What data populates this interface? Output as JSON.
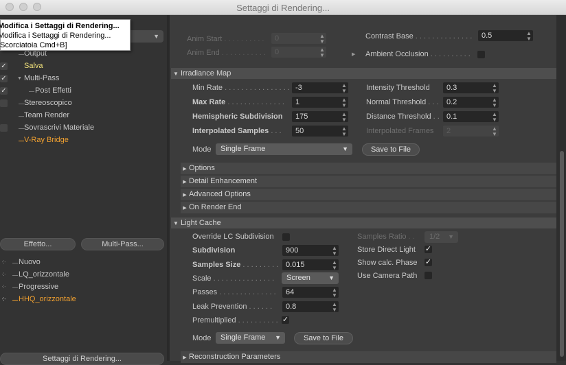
{
  "window": {
    "title": "Settaggi di Rendering..."
  },
  "tooltip": {
    "line1": "Modifica i Settaggi di Rendering...",
    "line2": "Modifica i Settaggi di Rendering...",
    "line3": "[Scorciatoia Cmd+B]"
  },
  "left": {
    "items": [
      {
        "label": "Output",
        "checked": false,
        "color": "#c8c8c8"
      },
      {
        "label": "Salva",
        "checked": true,
        "color": "#f0e07a"
      },
      {
        "label": "Multi-Pass",
        "checked": true,
        "color": "#c8c8c8"
      },
      {
        "label": "Post Effetti",
        "checked": true,
        "color": "#c8c8c8"
      },
      {
        "label": "Stereoscopico",
        "checked": false,
        "color": "#c8c8c8"
      },
      {
        "label": "Team Render",
        "checked": false,
        "color": "#c8c8c8"
      },
      {
        "label": "Sovrascrivi Materiale",
        "checked": false,
        "color": "#c8c8c8"
      },
      {
        "label": "V-Ray Bridge",
        "checked": false,
        "color": "#f0a030"
      }
    ],
    "effect_button": "Effetto...",
    "multipass_button": "Multi-Pass...",
    "presets": [
      {
        "label": "Nuovo",
        "color": "#c8c8c8"
      },
      {
        "label": "LQ_orizzontale",
        "color": "#c8c8c8"
      },
      {
        "label": "Progressive",
        "color": "#c8c8c8"
      },
      {
        "label": "HHQ_orizzontale",
        "color": "#f0a030"
      }
    ],
    "render_settings_button": "Settaggi di Rendering..."
  },
  "top": {
    "anim_start_label": "Anim Start",
    "anim_start_value": "0",
    "anim_end_label": "Anim End",
    "anim_end_value": "0",
    "contrast_base_label": "Contrast Base",
    "contrast_base_value": "0.5",
    "ambient_occlusion_label": "Ambient Occlusion"
  },
  "irradiance": {
    "title": "Irradiance Map",
    "min_rate_label": "Min Rate",
    "min_rate": "-3",
    "max_rate_label": "Max Rate",
    "max_rate": "1",
    "hemi_label": "Hemispheric Subdivision",
    "hemi": "175",
    "interp_label": "Interpolated Samples",
    "interp": "50",
    "intensity_label": "Intensity Threshold",
    "intensity": "0.3",
    "normal_label": "Normal Threshold",
    "normal": "0.2",
    "distance_label": "Distance Threshold",
    "distance": "0.1",
    "interp_frames_label": "Interpolated Frames",
    "interp_frames": "2",
    "mode_label": "Mode",
    "mode_value": "Single Frame",
    "save_button": "Save to File",
    "subsections": [
      "Options",
      "Detail Enhancement",
      "Advanced Options",
      "On Render End"
    ]
  },
  "lightcache": {
    "title": "Light Cache",
    "override_label": "Override LC Subdivision",
    "subdivision_label": "Subdivision",
    "subdivision": "900",
    "samples_size_label": "Samples Size",
    "samples_size": "0.015",
    "scale_label": "Scale",
    "scale_value": "Screen",
    "passes_label": "Passes",
    "passes": "64",
    "leak_label": "Leak Prevention",
    "leak": "0.8",
    "premult_label": "Premultiplied",
    "samples_ratio_label": "Samples Ratio",
    "samples_ratio": "1/2",
    "store_direct_label": "Store Direct Light",
    "show_phase_label": "Show calc. Phase",
    "camera_path_label": "Use Camera Path",
    "mode_label": "Mode",
    "mode_value": "Single Frame",
    "save_button": "Save to File",
    "reconstruction": "Reconstruction Parameters"
  },
  "glyphs": {
    "check": "✓",
    "tri_down": "▼",
    "tri_right": "▶",
    "spinner": "⇕"
  }
}
